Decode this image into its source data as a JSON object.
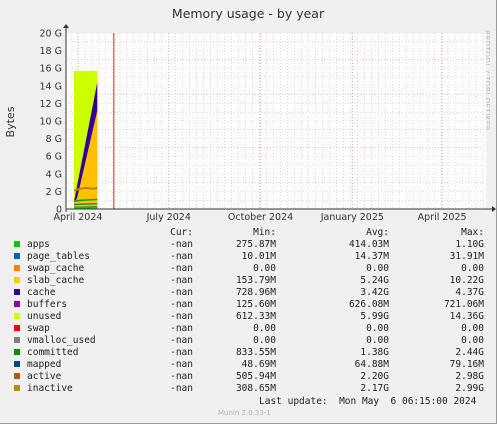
{
  "chart_data": {
    "type": "area",
    "title": "Memory usage - by year",
    "ylabel": "Bytes",
    "watermark": "RRDTOOL / TOBI OETIKER",
    "ylim": [
      0,
      20
    ],
    "y_ticks": [
      "0",
      "2 G",
      "4 G",
      "6 G",
      "8 G",
      "10 G",
      "12 G",
      "14 G",
      "16 G",
      "18 G",
      "20 G"
    ],
    "x_ticks": [
      "April 2024",
      "July 2024",
      "October 2024",
      "January 2025",
      "April 2025"
    ],
    "x_tick_dates": [
      "2024-04-01",
      "2024-07-01",
      "2024-10-01",
      "2025-01-01",
      "2025-04-01"
    ],
    "x_range": [
      "2024-03-20",
      "2025-05-15"
    ],
    "data_span": [
      "2024-03-28",
      "2024-05-06"
    ],
    "grid": true,
    "colors": {
      "background": "#f0f0f0",
      "plot": "#ffffff",
      "grid": "#e6a8a8",
      "major_grid": "#f5c0c0",
      "frame": "#9a9a9a",
      "unused": "#ccff00",
      "slab_cache": "#ffc000",
      "cache": "#330099",
      "committed": "#00aa00",
      "active": "#008040",
      "inactive": "#c08000",
      "mapped": "#005080",
      "apps": "#00cc00",
      "now_line": "#aa0000"
    }
  },
  "legend": {
    "headers": {
      "cur": "Cur:",
      "min": "Min:",
      "avg": "Avg:",
      "max": "Max:"
    },
    "rows": [
      {
        "name": "apps",
        "color": "#00cc00",
        "cur": "-nan",
        "min": "275.87M",
        "avg": "414.03M",
        "max": "1.10G"
      },
      {
        "name": "page_tables",
        "color": "#0066b3",
        "cur": "-nan",
        "min": "10.01M",
        "avg": "14.37M",
        "max": "31.91M"
      },
      {
        "name": "swap_cache",
        "color": "#ff8000",
        "cur": "-nan",
        "min": "0.00",
        "avg": "0.00",
        "max": "0.00"
      },
      {
        "name": "slab_cache",
        "color": "#ffcc00",
        "cur": "-nan",
        "min": "153.79M",
        "avg": "5.24G",
        "max": "10.22G"
      },
      {
        "name": "cache",
        "color": "#330099",
        "cur": "-nan",
        "min": "728.96M",
        "avg": "3.42G",
        "max": "4.37G"
      },
      {
        "name": "buffers",
        "color": "#990099",
        "cur": "-nan",
        "min": "125.60M",
        "avg": "626.08M",
        "max": "721.06M"
      },
      {
        "name": "unused",
        "color": "#ccff00",
        "cur": "-nan",
        "min": "612.33M",
        "avg": "5.99G",
        "max": "14.36G"
      },
      {
        "name": "swap",
        "color": "#ff0000",
        "cur": "-nan",
        "min": "0.00",
        "avg": "0.00",
        "max": "0.00"
      },
      {
        "name": "vmalloc_used",
        "color": "#808080",
        "cur": "-nan",
        "min": "0.00",
        "avg": "0.00",
        "max": "0.00"
      },
      {
        "name": "committed",
        "color": "#008f00",
        "cur": "-nan",
        "min": "833.55M",
        "avg": "1.38G",
        "max": "2.44G"
      },
      {
        "name": "mapped",
        "color": "#00487d",
        "cur": "-nan",
        "min": "48.69M",
        "avg": "64.88M",
        "max": "79.16M"
      },
      {
        "name": "active",
        "color": "#b35a00",
        "cur": "-nan",
        "min": "505.94M",
        "avg": "2.20G",
        "max": "2.98G"
      },
      {
        "name": "inactive",
        "color": "#b38f00",
        "cur": "-nan",
        "min": "308.65M",
        "avg": "2.17G",
        "max": "2.99G"
      }
    ]
  },
  "footer": {
    "last_update": "Last update:  Mon May  6 06:15:00 2024",
    "version": "Munin 2.0.33-1"
  }
}
